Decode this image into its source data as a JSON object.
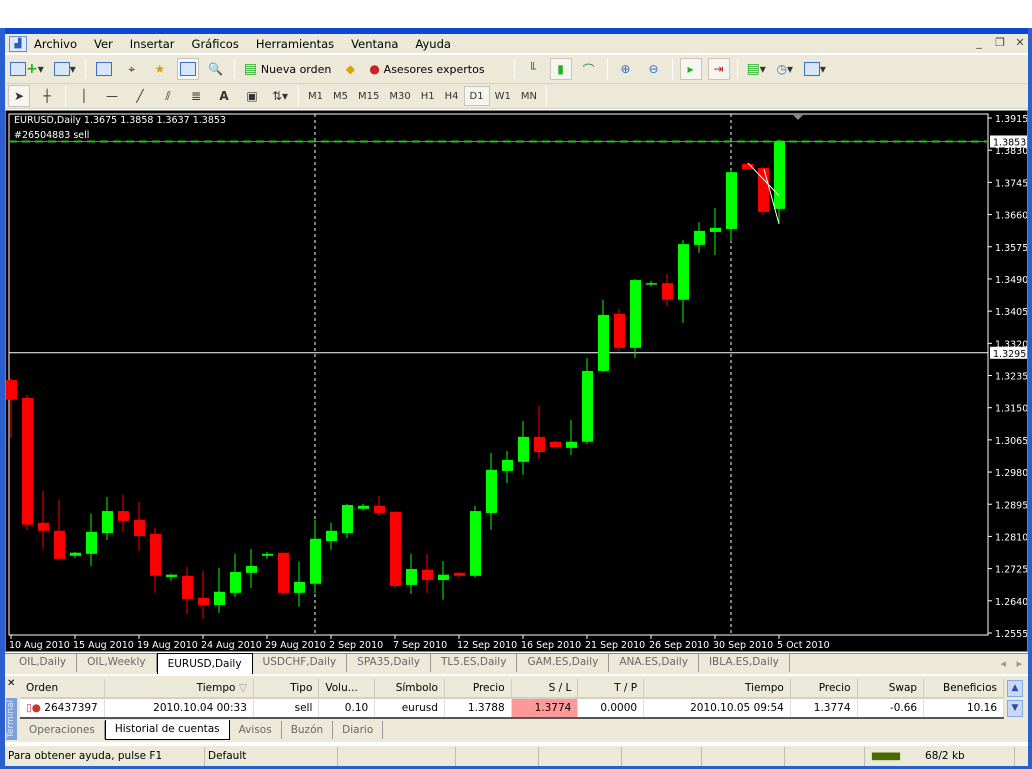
{
  "menu": {
    "items": [
      "Archivo",
      "Ver",
      "Insertar",
      "Gráficos",
      "Herramientas",
      "Ventana",
      "Ayuda"
    ]
  },
  "toolbar": {
    "new_order_label": "Nueva orden",
    "experts_label": "Asesores expertos",
    "timeframes": [
      "M1",
      "M5",
      "M15",
      "M30",
      "H1",
      "H4",
      "D1",
      "W1",
      "MN"
    ],
    "active_timeframe": "D1"
  },
  "chart": {
    "info": "EURUSD,Daily  1.3675 1.3858 1.3637 1.3853",
    "order_label": "#26504883 sell"
  },
  "chart_data": {
    "type": "candlestick",
    "symbol": "EURUSD",
    "timeframe": "Daily",
    "ylim": [
      1.2555,
      1.3915
    ],
    "y_ticks": [
      "1.3915",
      "1.3830",
      "1.3745",
      "1.3660",
      "1.3575",
      "1.3490",
      "1.3405",
      "1.3320",
      "1.3235",
      "1.3150",
      "1.3065",
      "1.2980",
      "1.2895",
      "1.2810",
      "1.2725",
      "1.2640",
      "1.2555"
    ],
    "x_tick_labels": [
      "10 Aug 2010",
      "15 Aug 2010",
      "19 Aug 2010",
      "24 Aug 2010",
      "29 Aug 2010",
      "2 Sep 2010",
      "7 Sep 2010",
      "12 Sep 2010",
      "16 Sep 2010",
      "21 Sep 2010",
      "26 Sep 2010",
      "30 Sep 2010",
      "5 Oct 2010"
    ],
    "bid_line": "1.3853",
    "crosshair_price": "1.3295",
    "colors": {
      "bull": "#00ff00",
      "bear": "#ff0000",
      "background": "#000000",
      "order_line": "#22bb22"
    },
    "ohlc": [
      [
        1.3223,
        1.3229,
        1.307,
        1.3171
      ],
      [
        1.3176,
        1.3184,
        1.2827,
        1.2841
      ],
      [
        1.2846,
        1.293,
        1.2777,
        1.2825
      ],
      [
        1.2825,
        1.2907,
        1.2751,
        1.2751
      ],
      [
        1.2759,
        1.2769,
        1.2753,
        1.2767
      ],
      [
        1.2764,
        1.287,
        1.2732,
        1.2822
      ],
      [
        1.2819,
        1.2914,
        1.2801,
        1.2877
      ],
      [
        1.2877,
        1.292,
        1.2822,
        1.2851
      ],
      [
        1.2854,
        1.2901,
        1.2772,
        1.2811
      ],
      [
        1.2817,
        1.2833,
        1.2661,
        1.2706
      ],
      [
        1.2703,
        1.2711,
        1.2693,
        1.2709
      ],
      [
        1.2706,
        1.273,
        1.2606,
        1.2645
      ],
      [
        1.2648,
        1.2719,
        1.2592,
        1.2629
      ],
      [
        1.2629,
        1.2727,
        1.2608,
        1.2664
      ],
      [
        1.2661,
        1.2764,
        1.265,
        1.2716
      ],
      [
        1.2714,
        1.2777,
        1.2674,
        1.2732
      ],
      [
        1.2759,
        1.2769,
        1.2751,
        1.2764
      ],
      [
        1.2767,
        1.2767,
        1.2656,
        1.2661
      ],
      [
        1.2661,
        1.2743,
        1.2624,
        1.269
      ],
      [
        1.2685,
        1.2854,
        1.2661,
        1.2804
      ],
      [
        1.2798,
        1.2846,
        1.2775,
        1.2825
      ],
      [
        1.2819,
        1.2896,
        1.2806,
        1.2893
      ],
      [
        1.2883,
        1.2896,
        1.288,
        1.2891
      ],
      [
        1.2891,
        1.2917,
        1.2864,
        1.2872
      ],
      [
        1.2875,
        1.2875,
        1.2674,
        1.2679
      ],
      [
        1.2682,
        1.2764,
        1.2658,
        1.2724
      ],
      [
        1.2722,
        1.2764,
        1.2661,
        1.2695
      ],
      [
        1.2695,
        1.2745,
        1.2643,
        1.2709
      ],
      [
        1.2714,
        1.2716,
        1.2701,
        1.2706
      ],
      [
        1.2706,
        1.2891,
        1.2701,
        1.2877
      ],
      [
        1.2872,
        1.3031,
        1.2827,
        1.2986
      ],
      [
        1.2983,
        1.3036,
        1.2951,
        1.3012
      ],
      [
        1.3007,
        1.3115,
        1.2973,
        1.3073
      ],
      [
        1.3073,
        1.3155,
        1.3015,
        1.3033
      ],
      [
        1.306,
        1.3062,
        1.3044,
        1.3046
      ],
      [
        1.3044,
        1.3118,
        1.3025,
        1.306
      ],
      [
        1.306,
        1.3281,
        1.3054,
        1.3247
      ],
      [
        1.3247,
        1.3435,
        1.3244,
        1.3395
      ],
      [
        1.3398,
        1.3411,
        1.33,
        1.3308
      ],
      [
        1.3308,
        1.349,
        1.3281,
        1.3487
      ],
      [
        1.3477,
        1.3485,
        1.3471,
        1.3479
      ],
      [
        1.3479,
        1.3503,
        1.3419,
        1.3435
      ],
      [
        1.3435,
        1.3593,
        1.3374,
        1.3582
      ],
      [
        1.358,
        1.364,
        1.3559,
        1.3617
      ],
      [
        1.3614,
        1.3677,
        1.3553,
        1.3625
      ],
      [
        1.3622,
        1.3778,
        1.359,
        1.3772
      ],
      [
        1.3794,
        1.3796,
        1.378,
        1.378
      ],
      [
        1.3783,
        1.3786,
        1.3659,
        1.3667
      ],
      [
        1.3675,
        1.3858,
        1.3637,
        1.3853
      ]
    ]
  },
  "chart_tabs": [
    {
      "label": "OIL,Daily",
      "active": false
    },
    {
      "label": "OIL,Weekly",
      "active": false
    },
    {
      "label": "EURUSD,Daily",
      "active": true
    },
    {
      "label": "USDCHF,Daily",
      "active": false
    },
    {
      "label": "SPA35,Daily",
      "active": false
    },
    {
      "label": "TL5.ES,Daily",
      "active": false
    },
    {
      "label": "GAM.ES,Daily",
      "active": false
    },
    {
      "label": "ANA.ES,Daily",
      "active": false
    },
    {
      "label": "IBLA.ES,Daily",
      "active": false
    }
  ],
  "terminal": {
    "side_label": "Terminal",
    "columns": [
      "Orden",
      "Tiempo",
      "Tipo",
      "Volu...",
      "Símbolo",
      "Precio",
      "S / L",
      "T / P",
      "Tiempo",
      "Precio",
      "Swap",
      "Beneficios"
    ],
    "rows": [
      [
        "26437397",
        "2010.10.04 00:33",
        "sell",
        "0.10",
        "eurusd",
        "1.3788",
        "1.3774",
        "0.0000",
        "2010.10.05 09:54",
        "1.3774",
        "-0.66",
        "10.16"
      ]
    ],
    "tabs": [
      "Operaciones",
      "Historial de cuentas",
      "Avisos",
      "Buzón",
      "Diario"
    ],
    "active_tab": "Historial de cuentas"
  },
  "status": {
    "help": "Para obtener ayuda, pulse F1",
    "profile": "Default",
    "traffic": "68/2 kb"
  }
}
